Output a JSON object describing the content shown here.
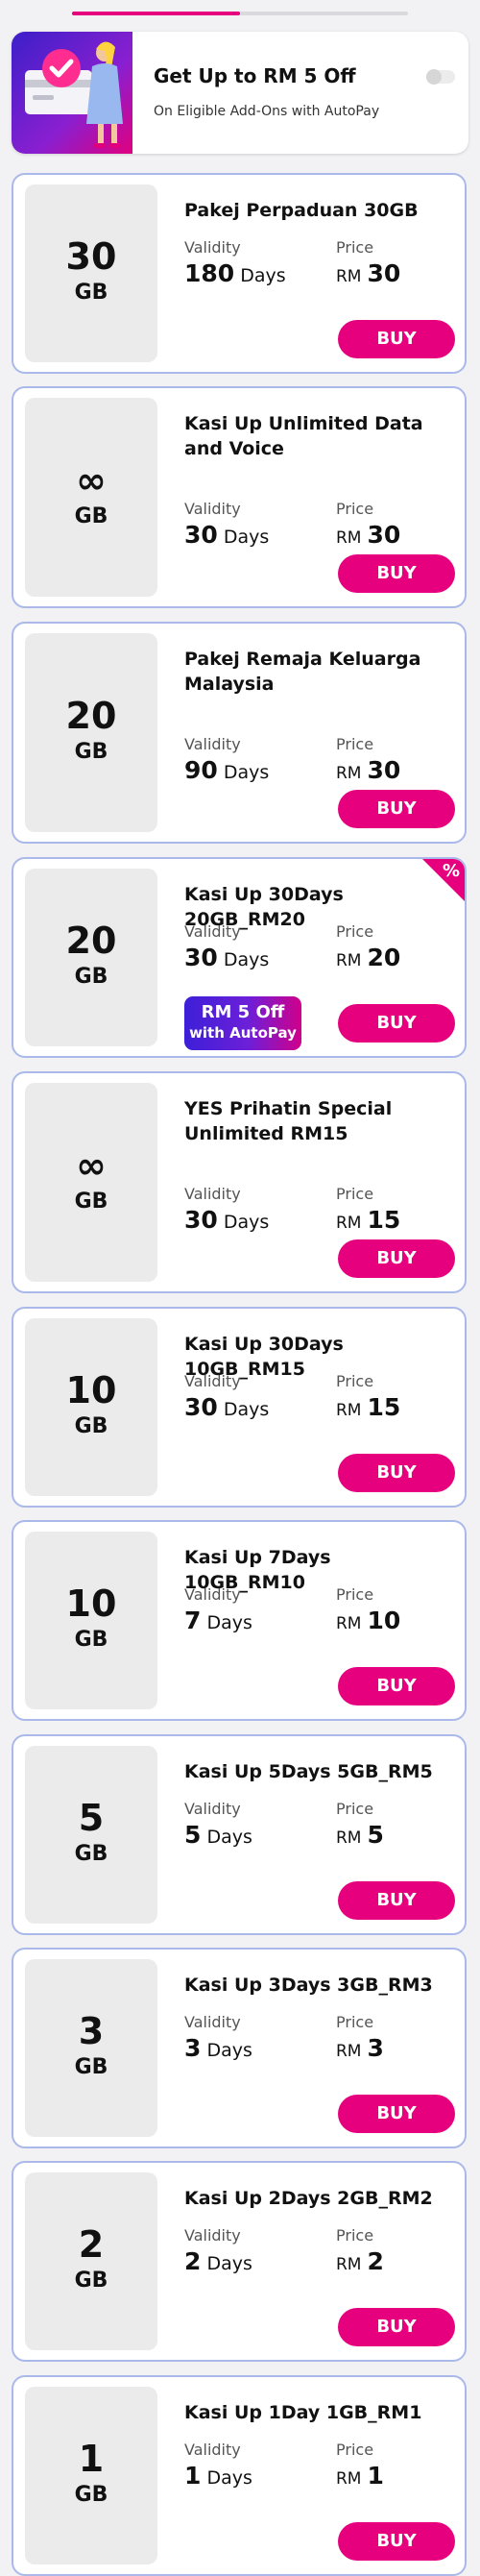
{
  "promo": {
    "title": "Get Up to RM 5 Off",
    "subtitle": "On Eligible Add-Ons with AutoPay"
  },
  "labels": {
    "validity": "Validity",
    "price": "Price",
    "days": "Days",
    "currency": "RM",
    "buy": "BUY",
    "unit": "GB"
  },
  "plans": [
    {
      "name": "Pakej Perpaduan 30GB",
      "quota": "30",
      "days": "180",
      "price": "30"
    },
    {
      "name": "Kasi Up Unlimited Data and Voice",
      "quota": "∞",
      "days": "30",
      "price": "30"
    },
    {
      "name": "Pakej Remaja Keluarga Malaysia",
      "quota": "20",
      "days": "90",
      "price": "30"
    },
    {
      "name": "Kasi Up 30Days 20GB_RM20",
      "quota": "20",
      "days": "30",
      "price": "20",
      "badge": "%",
      "autopay_line1": "RM 5 Off",
      "autopay_line2": "with AutoPay"
    },
    {
      "name": "YES Prihatin Special Unlimited RM15",
      "quota": "∞",
      "days": "30",
      "price": "15"
    },
    {
      "name": "Kasi Up 30Days 10GB_RM15",
      "quota": "10",
      "days": "30",
      "price": "15"
    },
    {
      "name": "Kasi Up 7Days 10GB_RM10",
      "quota": "10",
      "days": "7",
      "price": "10"
    },
    {
      "name": "Kasi Up 5Days 5GB_RM5",
      "quota": "5",
      "days": "5",
      "price": "5"
    },
    {
      "name": "Kasi Up 3Days 3GB_RM3",
      "quota": "3",
      "days": "3",
      "price": "3"
    },
    {
      "name": "Kasi Up 2Days 2GB_RM2",
      "quota": "2",
      "days": "2",
      "price": "2"
    },
    {
      "name": "Kasi Up 1Day 1GB_RM1",
      "quota": "1",
      "days": "1",
      "price": "1"
    }
  ],
  "colors": {
    "accent": "#e6007e",
    "card_border": "#aab9ea",
    "tile_bg": "#ebebeb"
  }
}
